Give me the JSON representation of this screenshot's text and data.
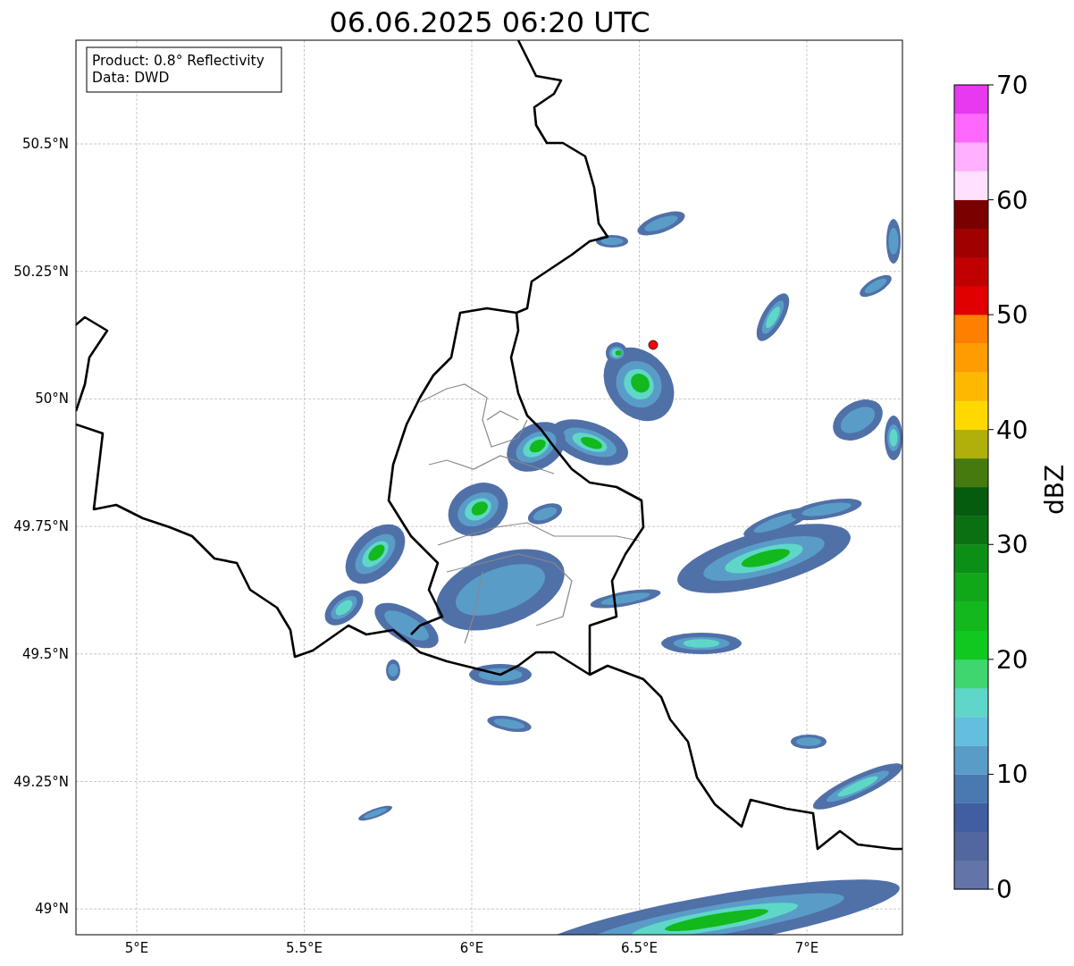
{
  "title": "06.06.2025 06:20 UTC",
  "info_box": {
    "lines": [
      "Product: 0.8° Reflectivity",
      "Data: DWD"
    ]
  },
  "map": {
    "latitude_ticks": [
      "50.5°N",
      "50.25°N",
      "50°N",
      "49.75°N",
      "49.5°N",
      "49.25°N",
      "49°N"
    ],
    "longitude_ticks": [
      "5°E",
      "5.5°E",
      "6°E",
      "6.5°E",
      "7°E"
    ]
  },
  "colorbar": {
    "label": "dBZ",
    "ticks": [
      "70",
      "60",
      "50",
      "40",
      "30",
      "20",
      "10",
      "0"
    ],
    "segments": [
      {
        "color": "#6375a8"
      },
      {
        "color": "#52679f"
      },
      {
        "color": "#425ea3"
      },
      {
        "color": "#4a78b0"
      },
      {
        "color": "#5a9cc8"
      },
      {
        "color": "#64bfde"
      },
      {
        "color": "#5fd7c8"
      },
      {
        "color": "#3fd670"
      },
      {
        "color": "#10c820"
      },
      {
        "color": "#12b81c"
      },
      {
        "color": "#10a818"
      },
      {
        "color": "#0c8f16"
      },
      {
        "color": "#0a7012"
      },
      {
        "color": "#065c0e"
      },
      {
        "color": "#467a0e"
      },
      {
        "color": "#b0b00a"
      },
      {
        "color": "#ffd800"
      },
      {
        "color": "#ffb800"
      },
      {
        "color": "#ff9c00"
      },
      {
        "color": "#ff7f00"
      },
      {
        "color": "#e00000"
      },
      {
        "color": "#c00000"
      },
      {
        "color": "#a00000"
      },
      {
        "color": "#7a0000"
      },
      {
        "color": "#ffe0ff"
      },
      {
        "color": "#ffb0ff"
      },
      {
        "color": "#ff68ff"
      },
      {
        "color": "#e838f0"
      }
    ]
  }
}
